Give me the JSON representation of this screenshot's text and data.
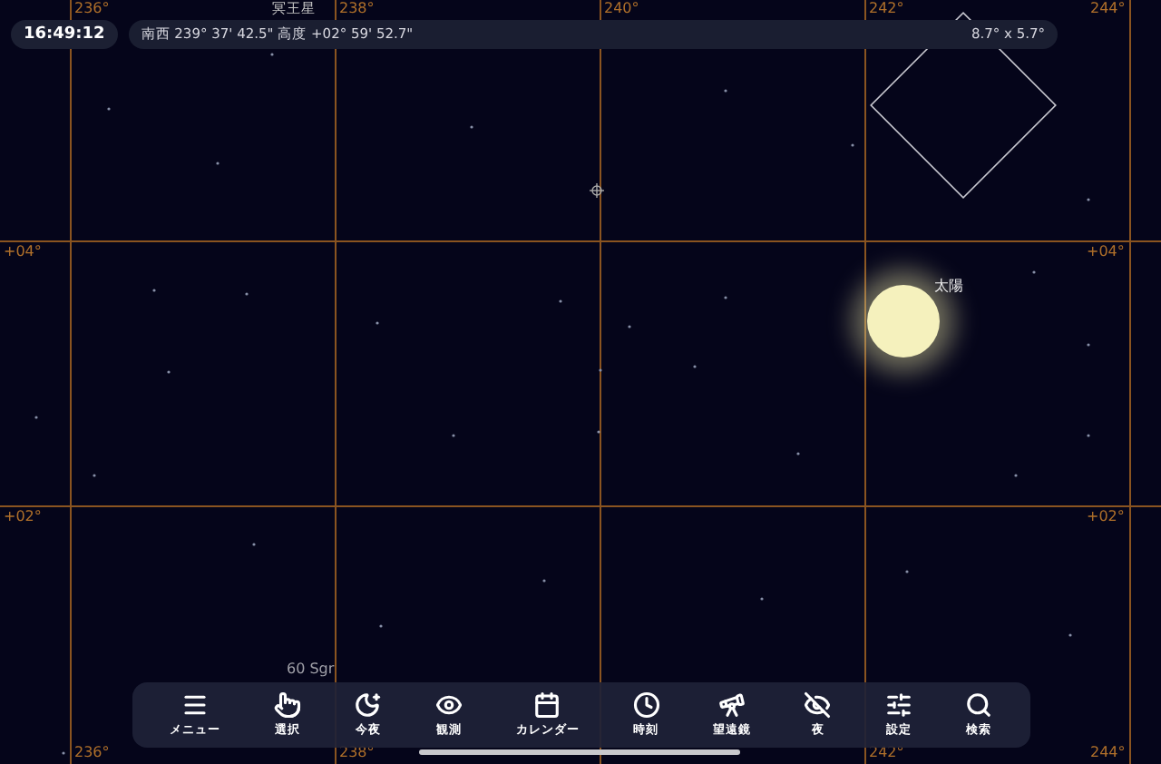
{
  "status": {
    "time": "16:49:12",
    "pointer_position": "南西 239° 37' 42.5\" 高度 +02° 59' 52.7\"",
    "field_of_view": "8.7° x 5.7°"
  },
  "grid": {
    "top_labels": [
      "236°",
      "238°",
      "240°",
      "242°",
      "244°"
    ],
    "bottom_labels": [
      "236°",
      "238°",
      "242°",
      "244°"
    ],
    "left_labels": [
      "+04°",
      "+02°"
    ],
    "right_labels": [
      "+04°",
      "+02°"
    ]
  },
  "objects": [
    {
      "kind": "planet",
      "label": "冥王星"
    },
    {
      "kind": "sun",
      "label": "太陽"
    },
    {
      "kind": "star",
      "label": "60 Sgr"
    }
  ],
  "toolbar": [
    {
      "label": "メニュー"
    },
    {
      "label": "選択"
    },
    {
      "label": "今夜"
    },
    {
      "label": "観測"
    },
    {
      "label": "カレンダー"
    },
    {
      "label": "時刻"
    },
    {
      "label": "望遠鏡"
    },
    {
      "label": "夜"
    },
    {
      "label": "設定"
    },
    {
      "label": "検索"
    }
  ]
}
